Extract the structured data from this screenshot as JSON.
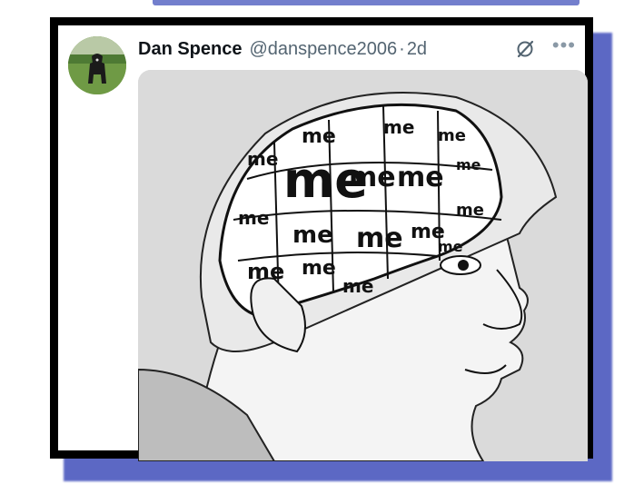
{
  "tweet": {
    "display_name": "Dan Spence",
    "handle": "@danspence2006",
    "separator": "·",
    "timestamp": "2d",
    "grok_icon": "grok-icon",
    "more_icon": "more-dots-icon"
  },
  "media": {
    "big_word": "me",
    "small_word": "me"
  },
  "colors": {
    "frame": "#000000",
    "shadow": "#4f5cc0",
    "name_text": "#0f1419",
    "secondary_text": "#536471",
    "image_bg": "#d9d9d9"
  }
}
